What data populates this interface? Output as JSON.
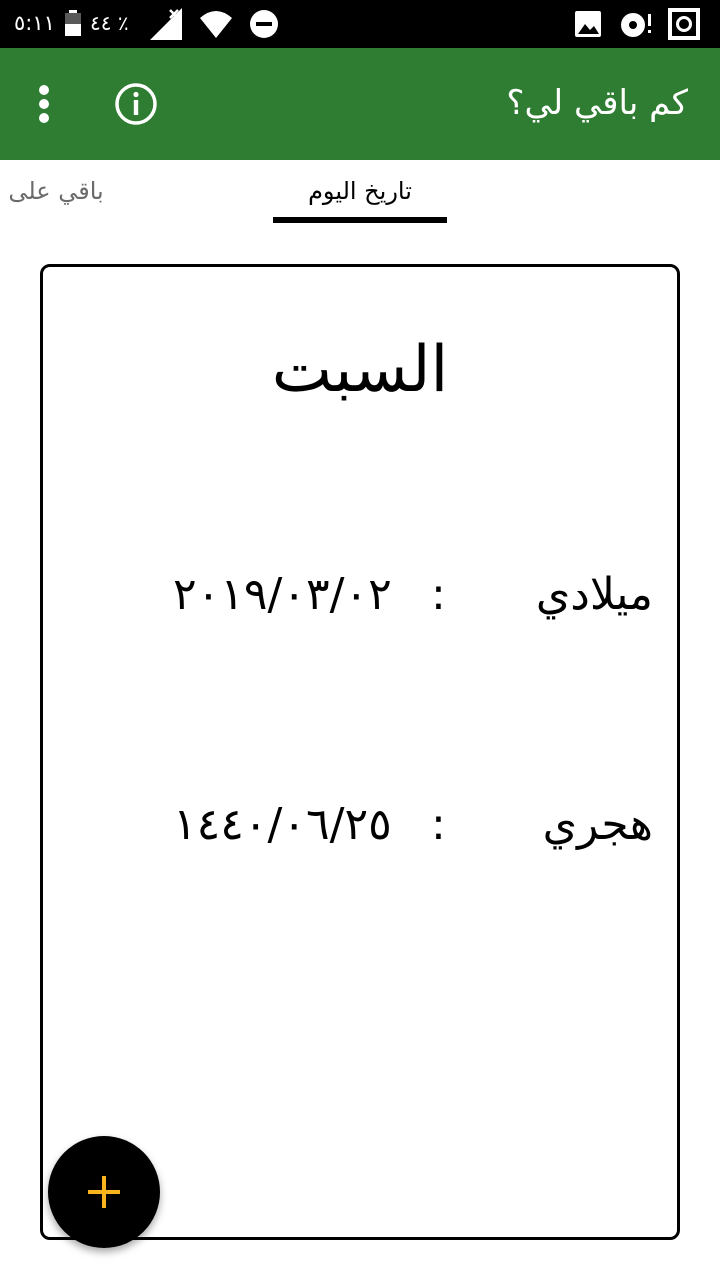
{
  "status_bar": {
    "time": "٥:١١",
    "battery": "٤٤ ٪",
    "icons": [
      "battery-icon",
      "signal-off-icon",
      "wifi-icon",
      "do-not-disturb-icon",
      "image-icon",
      "media-icon",
      "screenshot-icon"
    ]
  },
  "app_bar": {
    "title": "كم باقي لي؟",
    "info_icon": "info-icon",
    "menu_icon": "more-vert-icon",
    "background_color": "#2e7d32"
  },
  "tabs": [
    {
      "label": "تاريخ اليوم",
      "selected": true
    },
    {
      "label": "باقي على",
      "selected": false
    }
  ],
  "card": {
    "day_name": "السبت",
    "gregorian": {
      "label": "ميلادي",
      "separator": ":",
      "value": "٢٠١٩/٠٣/٠٢"
    },
    "hijri": {
      "label": "هجري",
      "separator": ":",
      "value": "١٤٤٠/٠٦/٢٥"
    }
  },
  "fab": {
    "icon": "add-icon",
    "icon_color": "#f9b31e"
  }
}
